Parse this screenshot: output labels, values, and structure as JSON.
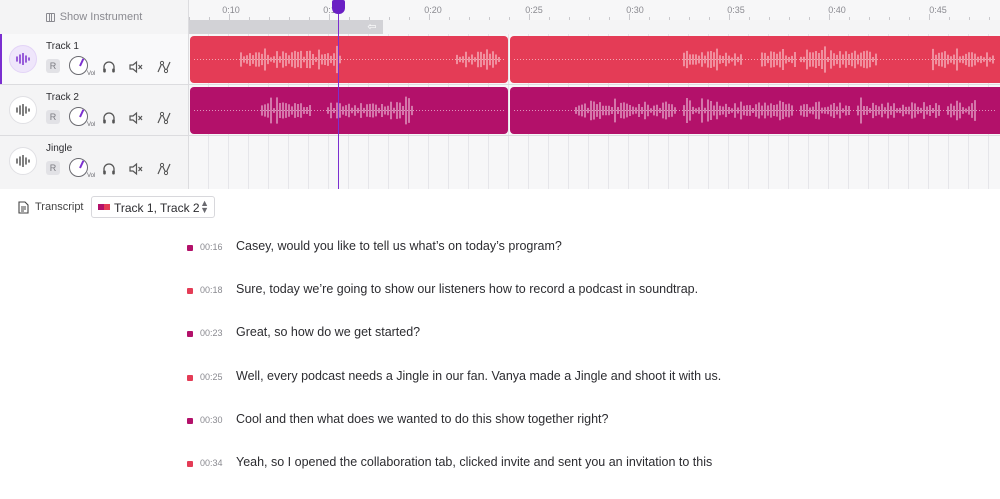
{
  "instrument_panel": {
    "label": "Show Instrument",
    "icon": "instrument-panel-icon"
  },
  "ruler": {
    "ticks": [
      "0:10",
      "0:15",
      "0:20",
      "0:25",
      "0:30",
      "0:35",
      "0:40",
      "0:45"
    ]
  },
  "tracks": [
    {
      "name": "Track 1",
      "record_label": "R",
      "vol_label": "Vol",
      "color": "#e43c56"
    },
    {
      "name": "Track 2",
      "record_label": "R",
      "vol_label": "Vol",
      "color": "#b3116a"
    },
    {
      "name": "Jingle",
      "record_label": "R",
      "vol_label": "Vol",
      "color": ""
    }
  ],
  "transcript": {
    "label": "Transcript",
    "selector_value": "Track 1, Track 2",
    "lines": [
      {
        "time": "00:16",
        "text": "Casey, would you like to tell us what’s on today’s program?",
        "color": "#b3116a"
      },
      {
        "time": "00:18",
        "text": "Sure, today we’re going to show our listeners how to record a podcast in soundtrap.",
        "color": "#e43c56"
      },
      {
        "time": "00:23",
        "text": "Great, so how do we get started?",
        "color": "#b3116a"
      },
      {
        "time": "00:25",
        "text": "Well, every podcast needs a Jingle in our fan. Vanya made a Jingle and shoot it with us.",
        "color": "#e43c56"
      },
      {
        "time": "00:30",
        "text": "Cool and then what does we wanted to do this show together right?",
        "color": "#b3116a"
      },
      {
        "time": "00:34",
        "text": "Yeah, so I opened the collaboration tab, clicked invite and sent you an invitation to this",
        "color": "#e43c56"
      }
    ]
  },
  "colors": {
    "accent": "#7b2fd0",
    "track1": "#e43c56",
    "track2": "#b3116a"
  }
}
